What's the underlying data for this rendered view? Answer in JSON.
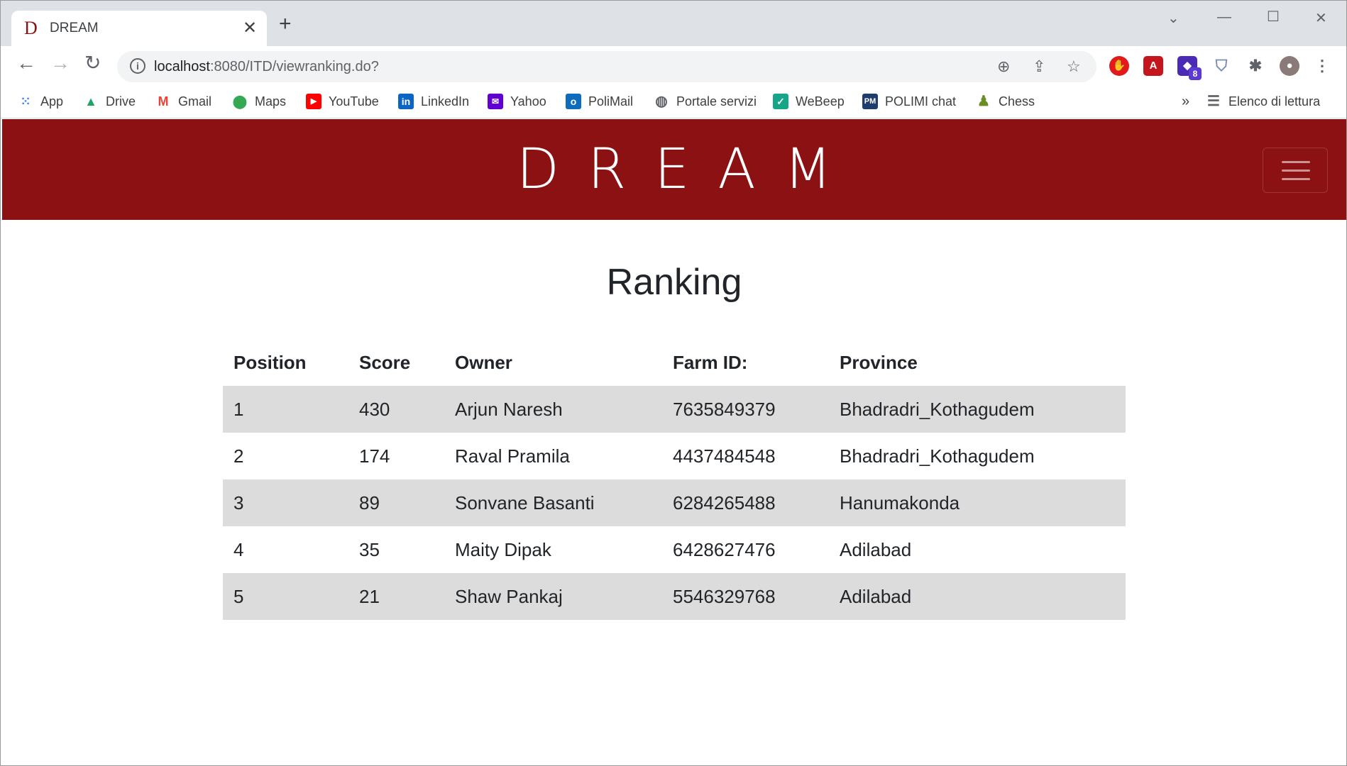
{
  "browser": {
    "tab_title": "DREAM",
    "tab_favicon": "D",
    "url_host": "localhost",
    "url_rest": ":8080/ITD/viewranking.do?",
    "extension_badge": "8",
    "bookmarks": [
      {
        "label": "App",
        "icon": "apps-grid-icon"
      },
      {
        "label": "Drive",
        "icon": "drive-icon"
      },
      {
        "label": "Gmail",
        "icon": "gmail-icon"
      },
      {
        "label": "Maps",
        "icon": "maps-icon"
      },
      {
        "label": "YouTube",
        "icon": "youtube-icon"
      },
      {
        "label": "LinkedIn",
        "icon": "linkedin-icon"
      },
      {
        "label": "Yahoo",
        "icon": "yahoo-icon"
      },
      {
        "label": "PoliMail",
        "icon": "outlook-icon"
      },
      {
        "label": "Portale servizi",
        "icon": "globe-icon"
      },
      {
        "label": "WeBeep",
        "icon": "webeep-icon"
      },
      {
        "label": "POLIMI chat",
        "icon": "polimi-chat-icon"
      },
      {
        "label": "Chess",
        "icon": "chess-icon"
      }
    ],
    "more_bookmarks": "»",
    "reading_list": "Elenco di lettura"
  },
  "page": {
    "brand": "DREAM",
    "heading": "Ranking",
    "colors": {
      "navbar": "#8c1113",
      "stripe": "#dcdcdc"
    }
  },
  "table": {
    "headers": [
      "Position",
      "Score",
      "Owner",
      "Farm ID:",
      "Province"
    ],
    "rows": [
      [
        "1",
        "430",
        "Arjun Naresh",
        "7635849379",
        "Bhadradri_Kothagudem"
      ],
      [
        "2",
        "174",
        "Raval Pramila",
        "4437484548",
        "Bhadradri_Kothagudem"
      ],
      [
        "3",
        "89",
        "Sonvane Basanti",
        "6284265488",
        "Hanumakonda"
      ],
      [
        "4",
        "35",
        "Maity Dipak",
        "6428627476",
        "Adilabad"
      ],
      [
        "5",
        "21",
        "Shaw Pankaj",
        "5546329768",
        "Adilabad"
      ]
    ]
  }
}
